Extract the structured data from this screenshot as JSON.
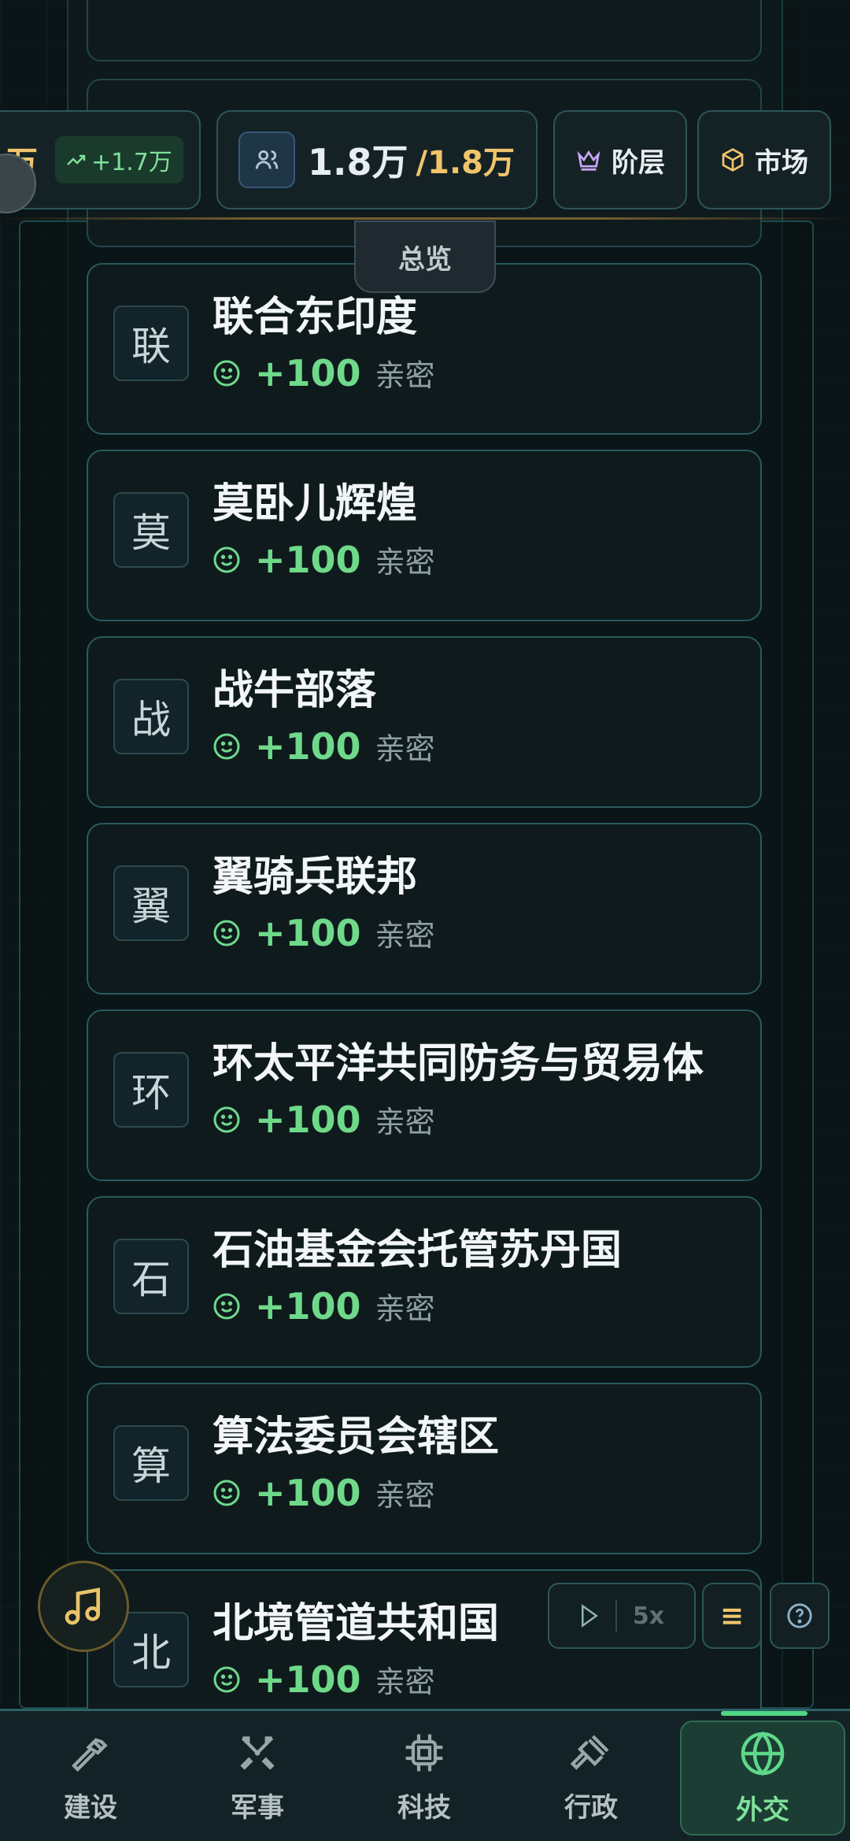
{
  "topbar": {
    "pop_wan_suffix": "万",
    "pop_trend": "+1.7万",
    "population_value": "1.8万",
    "population_max": "/1.8万",
    "class_button": "阶层",
    "market_button": "市场",
    "overview_tab": "总览"
  },
  "nations": [
    {
      "initial": "联",
      "name": "联合东印度",
      "score": "+100",
      "relation": "亲密"
    },
    {
      "initial": "莫",
      "name": "莫卧儿辉煌",
      "score": "+100",
      "relation": "亲密"
    },
    {
      "initial": "战",
      "name": "战牛部落",
      "score": "+100",
      "relation": "亲密"
    },
    {
      "initial": "翼",
      "name": "翼骑兵联邦",
      "score": "+100",
      "relation": "亲密"
    },
    {
      "initial": "环",
      "name": "环太平洋共同防务与贸易体",
      "score": "+100",
      "relation": "亲密"
    },
    {
      "initial": "石",
      "name": "石油基金会托管苏丹国",
      "score": "+100",
      "relation": "亲密"
    },
    {
      "initial": "算",
      "name": "算法委员会辖区",
      "score": "+100",
      "relation": "亲密"
    },
    {
      "initial": "北",
      "name": "北境管道共和国",
      "score": "+100",
      "relation": "亲密"
    }
  ],
  "speed": {
    "multiplier": "5x"
  },
  "menu_icon": "≡",
  "nav": [
    {
      "label": "建设",
      "icon": "hammer-icon"
    },
    {
      "label": "军事",
      "icon": "crossed-swords-icon"
    },
    {
      "label": "科技",
      "icon": "chip-icon"
    },
    {
      "label": "行政",
      "icon": "gavel-icon"
    },
    {
      "label": "外交",
      "icon": "globe-icon",
      "active": true
    }
  ],
  "colors": {
    "accent_green": "#6fd98a",
    "accent_gold": "#f1c46b",
    "bg": "#0b1416"
  }
}
